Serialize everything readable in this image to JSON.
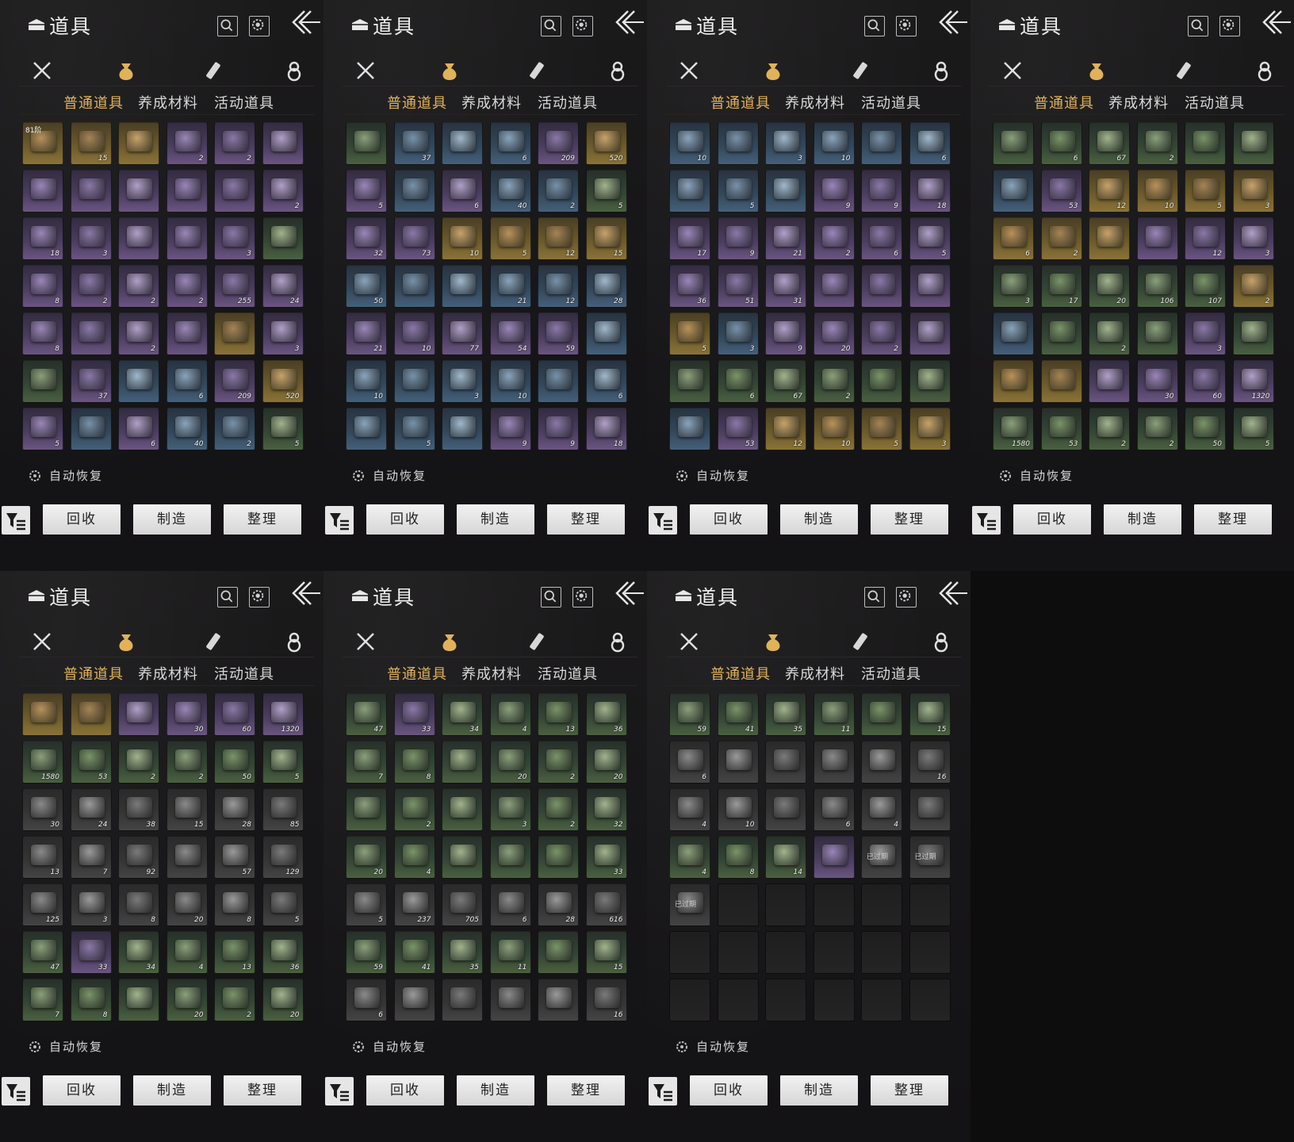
{
  "ui": {
    "title": "道具",
    "subtabs": [
      "普通道具",
      "养成材料",
      "活动道具"
    ],
    "auto_restore": "自动恢复",
    "buttons": {
      "recycle": "回收",
      "craft": "制造",
      "sort": "整理"
    },
    "icons": {
      "chest": "chest-icon",
      "search": "search-icon",
      "gear": "gear-icon",
      "back": "back-arrow-icon",
      "categories": [
        "crossed-swords-icon",
        "pouch-icon",
        "scroll-icon",
        "gourd-icon"
      ],
      "filter": "filter-icon"
    },
    "colors": {
      "active_tab": "#e0b25a",
      "text": "#d8d8d8",
      "background": "#171618"
    }
  },
  "panels": [
    {
      "items": [
        {
          "r": "gold",
          "c": "",
          "t": "81阶"
        },
        {
          "r": "gold",
          "c": "15"
        },
        {
          "r": "gold",
          "c": ""
        },
        {
          "r": "purple",
          "c": "2"
        },
        {
          "r": "purple",
          "c": "2"
        },
        {
          "r": "purple",
          "c": ""
        },
        {
          "r": "purple",
          "c": ""
        },
        {
          "r": "purple",
          "c": ""
        },
        {
          "r": "purple",
          "c": ""
        },
        {
          "r": "purple",
          "c": ""
        },
        {
          "r": "purple",
          "c": ""
        },
        {
          "r": "purple",
          "c": "2"
        },
        {
          "r": "purple",
          "c": "18"
        },
        {
          "r": "purple",
          "c": "3"
        },
        {
          "r": "purple",
          "c": ""
        },
        {
          "r": "purple",
          "c": ""
        },
        {
          "r": "purple",
          "c": "3"
        },
        {
          "r": "green",
          "c": ""
        },
        {
          "r": "purple",
          "c": "8"
        },
        {
          "r": "purple",
          "c": "2"
        },
        {
          "r": "purple",
          "c": "2"
        },
        {
          "r": "purple",
          "c": "2"
        },
        {
          "r": "purple",
          "c": "255"
        },
        {
          "r": "purple",
          "c": "24"
        },
        {
          "r": "purple",
          "c": "8"
        },
        {
          "r": "purple",
          "c": ""
        },
        {
          "r": "purple",
          "c": "2"
        },
        {
          "r": "purple",
          "c": ""
        },
        {
          "r": "gold",
          "c": ""
        },
        {
          "r": "purple",
          "c": "3"
        },
        {
          "r": "green",
          "c": ""
        },
        {
          "r": "purple",
          "c": "37"
        },
        {
          "r": "blue",
          "c": ""
        },
        {
          "r": "blue",
          "c": "6"
        },
        {
          "r": "purple",
          "c": "209"
        },
        {
          "r": "gold",
          "c": "520"
        },
        {
          "r": "purple",
          "c": "5"
        },
        {
          "r": "blue",
          "c": ""
        },
        {
          "r": "purple",
          "c": "6"
        },
        {
          "r": "blue",
          "c": "40"
        },
        {
          "r": "blue",
          "c": "2"
        },
        {
          "r": "green",
          "c": "5"
        }
      ]
    },
    {
      "items": [
        {
          "r": "green",
          "c": ""
        },
        {
          "r": "blue",
          "c": "37"
        },
        {
          "r": "blue",
          "c": ""
        },
        {
          "r": "blue",
          "c": "6"
        },
        {
          "r": "purple",
          "c": "209"
        },
        {
          "r": "gold",
          "c": "520"
        },
        {
          "r": "purple",
          "c": "5"
        },
        {
          "r": "blue",
          "c": ""
        },
        {
          "r": "purple",
          "c": "6"
        },
        {
          "r": "blue",
          "c": "40"
        },
        {
          "r": "blue",
          "c": "2"
        },
        {
          "r": "green",
          "c": "5"
        },
        {
          "r": "purple",
          "c": "32"
        },
        {
          "r": "purple",
          "c": "73"
        },
        {
          "r": "gold",
          "c": "10"
        },
        {
          "r": "gold",
          "c": "5"
        },
        {
          "r": "gold",
          "c": "12"
        },
        {
          "r": "gold",
          "c": "15"
        },
        {
          "r": "blue",
          "c": "50"
        },
        {
          "r": "blue",
          "c": ""
        },
        {
          "r": "blue",
          "c": ""
        },
        {
          "r": "blue",
          "c": "21"
        },
        {
          "r": "blue",
          "c": "12"
        },
        {
          "r": "blue",
          "c": "28"
        },
        {
          "r": "purple",
          "c": "21"
        },
        {
          "r": "purple",
          "c": "10"
        },
        {
          "r": "purple",
          "c": "77"
        },
        {
          "r": "purple",
          "c": "54"
        },
        {
          "r": "purple",
          "c": "59"
        },
        {
          "r": "blue",
          "c": ""
        },
        {
          "r": "blue",
          "c": "10"
        },
        {
          "r": "blue",
          "c": ""
        },
        {
          "r": "blue",
          "c": "3"
        },
        {
          "r": "blue",
          "c": "10"
        },
        {
          "r": "blue",
          "c": ""
        },
        {
          "r": "blue",
          "c": "6"
        },
        {
          "r": "blue",
          "c": ""
        },
        {
          "r": "blue",
          "c": "5"
        },
        {
          "r": "blue",
          "c": ""
        },
        {
          "r": "purple",
          "c": "9"
        },
        {
          "r": "purple",
          "c": "9"
        },
        {
          "r": "purple",
          "c": "18"
        }
      ]
    },
    {
      "items": [
        {
          "r": "blue",
          "c": "10"
        },
        {
          "r": "blue",
          "c": ""
        },
        {
          "r": "blue",
          "c": "3"
        },
        {
          "r": "blue",
          "c": "10"
        },
        {
          "r": "blue",
          "c": ""
        },
        {
          "r": "blue",
          "c": "6"
        },
        {
          "r": "blue",
          "c": ""
        },
        {
          "r": "blue",
          "c": "5"
        },
        {
          "r": "blue",
          "c": ""
        },
        {
          "r": "purple",
          "c": "9"
        },
        {
          "r": "purple",
          "c": "9"
        },
        {
          "r": "purple",
          "c": "18"
        },
        {
          "r": "purple",
          "c": "17"
        },
        {
          "r": "purple",
          "c": "9"
        },
        {
          "r": "purple",
          "c": "21"
        },
        {
          "r": "purple",
          "c": "2"
        },
        {
          "r": "purple",
          "c": "6"
        },
        {
          "r": "purple",
          "c": "5"
        },
        {
          "r": "purple",
          "c": "36"
        },
        {
          "r": "purple",
          "c": "51"
        },
        {
          "r": "purple",
          "c": "31"
        },
        {
          "r": "purple",
          "c": ""
        },
        {
          "r": "purple",
          "c": ""
        },
        {
          "r": "purple",
          "c": ""
        },
        {
          "r": "gold",
          "c": "5"
        },
        {
          "r": "blue",
          "c": "3"
        },
        {
          "r": "purple",
          "c": "9"
        },
        {
          "r": "purple",
          "c": "20"
        },
        {
          "r": "purple",
          "c": "2"
        },
        {
          "r": "purple",
          "c": ""
        },
        {
          "r": "green",
          "c": ""
        },
        {
          "r": "green",
          "c": "6"
        },
        {
          "r": "green",
          "c": "67"
        },
        {
          "r": "green",
          "c": "2"
        },
        {
          "r": "green",
          "c": ""
        },
        {
          "r": "green",
          "c": ""
        },
        {
          "r": "blue",
          "c": ""
        },
        {
          "r": "purple",
          "c": "53"
        },
        {
          "r": "gold",
          "c": "12"
        },
        {
          "r": "gold",
          "c": "10"
        },
        {
          "r": "gold",
          "c": "5"
        },
        {
          "r": "gold",
          "c": "3"
        }
      ]
    },
    {
      "items": [
        {
          "r": "green",
          "c": ""
        },
        {
          "r": "green",
          "c": "6"
        },
        {
          "r": "green",
          "c": "67"
        },
        {
          "r": "green",
          "c": "2"
        },
        {
          "r": "green",
          "c": ""
        },
        {
          "r": "green",
          "c": ""
        },
        {
          "r": "blue",
          "c": ""
        },
        {
          "r": "purple",
          "c": "53"
        },
        {
          "r": "gold",
          "c": "12"
        },
        {
          "r": "gold",
          "c": "10"
        },
        {
          "r": "gold",
          "c": "5"
        },
        {
          "r": "gold",
          "c": "3"
        },
        {
          "r": "gold",
          "c": "6"
        },
        {
          "r": "gold",
          "c": "2"
        },
        {
          "r": "gold",
          "c": ""
        },
        {
          "r": "purple",
          "c": ""
        },
        {
          "r": "purple",
          "c": "12"
        },
        {
          "r": "purple",
          "c": "3"
        },
        {
          "r": "green",
          "c": "3"
        },
        {
          "r": "green",
          "c": "17"
        },
        {
          "r": "green",
          "c": "20"
        },
        {
          "r": "green",
          "c": "106"
        },
        {
          "r": "green",
          "c": "107"
        },
        {
          "r": "gold",
          "c": "2"
        },
        {
          "r": "blue",
          "c": ""
        },
        {
          "r": "green",
          "c": ""
        },
        {
          "r": "green",
          "c": "2"
        },
        {
          "r": "green",
          "c": ""
        },
        {
          "r": "purple",
          "c": "3"
        },
        {
          "r": "green",
          "c": ""
        },
        {
          "r": "gold",
          "c": ""
        },
        {
          "r": "gold",
          "c": ""
        },
        {
          "r": "purple",
          "c": ""
        },
        {
          "r": "purple",
          "c": "30"
        },
        {
          "r": "purple",
          "c": "60"
        },
        {
          "r": "purple",
          "c": "1320"
        },
        {
          "r": "green",
          "c": "1580"
        },
        {
          "r": "green",
          "c": "53"
        },
        {
          "r": "green",
          "c": "2"
        },
        {
          "r": "green",
          "c": "2"
        },
        {
          "r": "green",
          "c": "50"
        },
        {
          "r": "green",
          "c": "5"
        }
      ]
    },
    {
      "items": [
        {
          "r": "gold",
          "c": ""
        },
        {
          "r": "gold",
          "c": ""
        },
        {
          "r": "purple",
          "c": ""
        },
        {
          "r": "purple",
          "c": "30"
        },
        {
          "r": "purple",
          "c": "60"
        },
        {
          "r": "purple",
          "c": "1320"
        },
        {
          "r": "green",
          "c": "1580"
        },
        {
          "r": "green",
          "c": "53"
        },
        {
          "r": "green",
          "c": "2"
        },
        {
          "r": "green",
          "c": "2"
        },
        {
          "r": "green",
          "c": "50"
        },
        {
          "r": "green",
          "c": "5"
        },
        {
          "r": "gray",
          "c": "30"
        },
        {
          "r": "gray",
          "c": "24"
        },
        {
          "r": "gray",
          "c": "38"
        },
        {
          "r": "gray",
          "c": "15"
        },
        {
          "r": "gray",
          "c": "28"
        },
        {
          "r": "gray",
          "c": "85"
        },
        {
          "r": "gray",
          "c": "13"
        },
        {
          "r": "gray",
          "c": "7"
        },
        {
          "r": "gray",
          "c": "92"
        },
        {
          "r": "gray",
          "c": ""
        },
        {
          "r": "gray",
          "c": "57"
        },
        {
          "r": "gray",
          "c": "129"
        },
        {
          "r": "gray",
          "c": "125"
        },
        {
          "r": "gray",
          "c": "3"
        },
        {
          "r": "gray",
          "c": "8"
        },
        {
          "r": "gray",
          "c": "20"
        },
        {
          "r": "gray",
          "c": "8"
        },
        {
          "r": "gray",
          "c": "5"
        },
        {
          "r": "green",
          "c": "47"
        },
        {
          "r": "purple",
          "c": "33"
        },
        {
          "r": "green",
          "c": "34"
        },
        {
          "r": "green",
          "c": "4"
        },
        {
          "r": "green",
          "c": "13"
        },
        {
          "r": "green",
          "c": "36"
        },
        {
          "r": "green",
          "c": "7"
        },
        {
          "r": "green",
          "c": "8"
        },
        {
          "r": "green",
          "c": ""
        },
        {
          "r": "green",
          "c": "20"
        },
        {
          "r": "green",
          "c": "2"
        },
        {
          "r": "green",
          "c": "20"
        }
      ]
    },
    {
      "items": [
        {
          "r": "green",
          "c": "47"
        },
        {
          "r": "purple",
          "c": "33"
        },
        {
          "r": "green",
          "c": "34"
        },
        {
          "r": "green",
          "c": "4"
        },
        {
          "r": "green",
          "c": "13"
        },
        {
          "r": "green",
          "c": "36"
        },
        {
          "r": "green",
          "c": "7"
        },
        {
          "r": "green",
          "c": "8"
        },
        {
          "r": "green",
          "c": ""
        },
        {
          "r": "green",
          "c": "20"
        },
        {
          "r": "green",
          "c": "2"
        },
        {
          "r": "green",
          "c": "20"
        },
        {
          "r": "green",
          "c": ""
        },
        {
          "r": "green",
          "c": "2"
        },
        {
          "r": "green",
          "c": ""
        },
        {
          "r": "green",
          "c": "3"
        },
        {
          "r": "green",
          "c": "2"
        },
        {
          "r": "green",
          "c": "32"
        },
        {
          "r": "green",
          "c": "20"
        },
        {
          "r": "green",
          "c": "4"
        },
        {
          "r": "green",
          "c": ""
        },
        {
          "r": "green",
          "c": ""
        },
        {
          "r": "green",
          "c": ""
        },
        {
          "r": "green",
          "c": "33"
        },
        {
          "r": "gray",
          "c": "5"
        },
        {
          "r": "gray",
          "c": "237"
        },
        {
          "r": "gray",
          "c": "705"
        },
        {
          "r": "gray",
          "c": "6"
        },
        {
          "r": "gray",
          "c": "28"
        },
        {
          "r": "gray",
          "c": "616"
        },
        {
          "r": "green",
          "c": "59"
        },
        {
          "r": "green",
          "c": "41"
        },
        {
          "r": "green",
          "c": "35"
        },
        {
          "r": "green",
          "c": "11"
        },
        {
          "r": "green",
          "c": ""
        },
        {
          "r": "green",
          "c": "15"
        },
        {
          "r": "gray",
          "c": "6"
        },
        {
          "r": "gray",
          "c": ""
        },
        {
          "r": "gray",
          "c": ""
        },
        {
          "r": "gray",
          "c": ""
        },
        {
          "r": "gray",
          "c": ""
        },
        {
          "r": "gray",
          "c": "16"
        }
      ]
    },
    {
      "items": [
        {
          "r": "green",
          "c": "59"
        },
        {
          "r": "green",
          "c": "41"
        },
        {
          "r": "green",
          "c": "35"
        },
        {
          "r": "green",
          "c": "11"
        },
        {
          "r": "green",
          "c": ""
        },
        {
          "r": "green",
          "c": "15"
        },
        {
          "r": "gray",
          "c": "6"
        },
        {
          "r": "gray",
          "c": ""
        },
        {
          "r": "gray",
          "c": ""
        },
        {
          "r": "gray",
          "c": ""
        },
        {
          "r": "gray",
          "c": ""
        },
        {
          "r": "gray",
          "c": "16"
        },
        {
          "r": "gray",
          "c": "4"
        },
        {
          "r": "gray",
          "c": "10"
        },
        {
          "r": "gray",
          "c": ""
        },
        {
          "r": "gray",
          "c": "6"
        },
        {
          "r": "gray",
          "c": "4"
        },
        {
          "r": "gray",
          "c": ""
        },
        {
          "r": "green",
          "c": "4"
        },
        {
          "r": "green",
          "c": "8"
        },
        {
          "r": "green",
          "c": "14"
        },
        {
          "r": "purple",
          "c": ""
        },
        {
          "r": "gray",
          "c": "",
          "t": "已过期"
        },
        {
          "r": "gray",
          "c": "",
          "t": "已过期"
        },
        {
          "r": "gray",
          "c": "",
          "t": "已过期"
        },
        {
          "r": "empty",
          "c": ""
        },
        {
          "r": "empty",
          "c": ""
        },
        {
          "r": "empty",
          "c": ""
        },
        {
          "r": "empty",
          "c": ""
        },
        {
          "r": "empty",
          "c": ""
        },
        {
          "r": "empty",
          "c": ""
        },
        {
          "r": "empty",
          "c": ""
        },
        {
          "r": "empty",
          "c": ""
        },
        {
          "r": "empty",
          "c": ""
        },
        {
          "r": "empty",
          "c": ""
        },
        {
          "r": "empty",
          "c": ""
        },
        {
          "r": "empty",
          "c": ""
        },
        {
          "r": "empty",
          "c": ""
        },
        {
          "r": "empty",
          "c": ""
        },
        {
          "r": "empty",
          "c": ""
        },
        {
          "r": "empty",
          "c": ""
        },
        {
          "r": "empty",
          "c": ""
        }
      ]
    }
  ]
}
